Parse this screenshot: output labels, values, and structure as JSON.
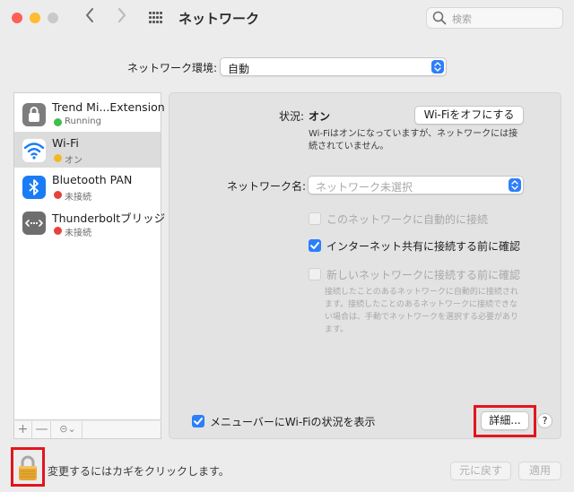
{
  "window": {
    "title": "ネットワーク"
  },
  "search": {
    "placeholder": "検索"
  },
  "location": {
    "label": "ネットワーク環境:",
    "value": "自動"
  },
  "services": [
    {
      "name": "Trend Mi...Extension",
      "status": "Running",
      "status_color": "#3fbf4c",
      "icon": "lock-icon"
    },
    {
      "name": "Wi-Fi",
      "status": "オン",
      "status_color": "#f0b92a",
      "icon": "wifi-icon"
    },
    {
      "name": "Bluetooth PAN",
      "status": "未接続",
      "status_color": "#e6423a",
      "icon": "bluetooth-icon"
    },
    {
      "name": "Thunderboltブリッジ",
      "status": "未接続",
      "status_color": "#e6423a",
      "icon": "thunderbolt-bridge-icon"
    }
  ],
  "sidebar_controls": {
    "add": "+",
    "remove": "—",
    "action": "⊝⌄"
  },
  "status": {
    "label": "状況:",
    "value": "オン",
    "toggle_button": "Wi-Fiをオフにする",
    "description_line1": "Wi-Fiはオンになっていますが、ネットワークには接",
    "description_line2": "続されていません。"
  },
  "network_name": {
    "label": "ネットワーク名:",
    "placeholder": "ネットワーク未選択"
  },
  "options": {
    "auto_join": "このネットワークに自動的に接続",
    "ask_hotspot": "インターネット共有に接続する前に確認",
    "ask_new": "新しいネットワークに接続する前に確認",
    "ask_new_desc1": "接続したことのあるネットワークに自動的に接続され",
    "ask_new_desc2": "ます。接続したことのあるネットワークに接続できな",
    "ask_new_desc3": "い場合は、手動でネットワークを選択する必要があり",
    "ask_new_desc4": "ます。"
  },
  "menubar_option": "メニューバーにWi-Fiの状況を表示",
  "advanced_button": "詳細...",
  "help_button": "?",
  "footer": {
    "lock_text": "変更するにはカギをクリックします。",
    "revert": "元に戻す",
    "apply": "適用"
  },
  "colors": {
    "accent": "#2d7ff9",
    "highlight": "#e0161f"
  }
}
